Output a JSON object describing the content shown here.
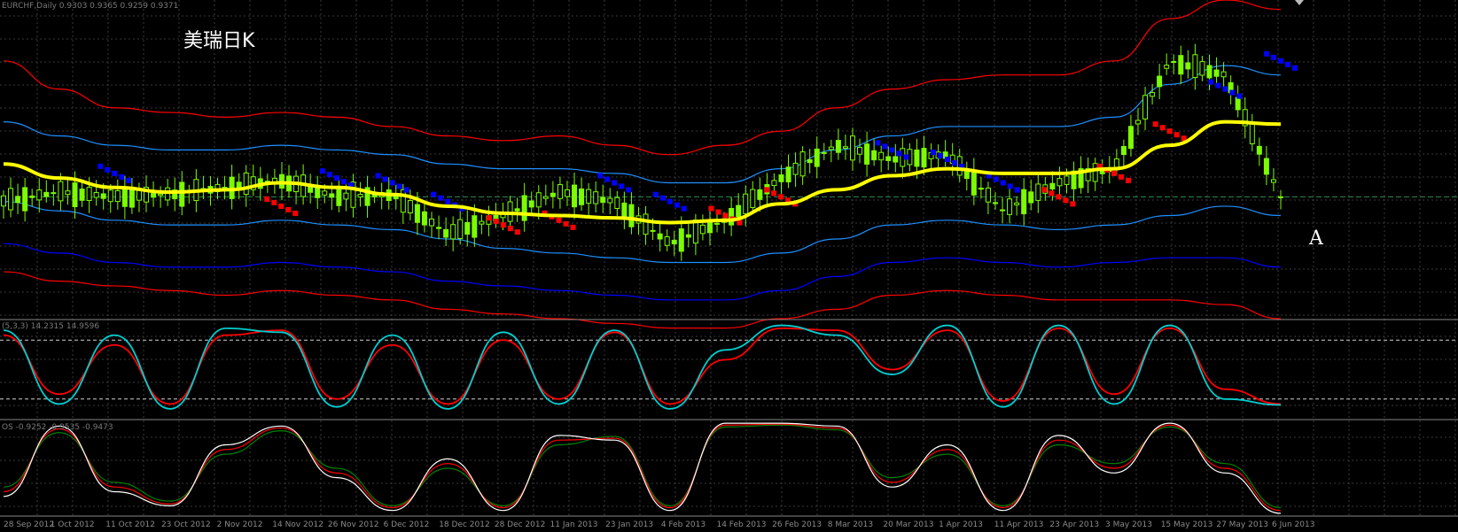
{
  "header": {
    "symbol_label": "EURCHF,Daily  0.9303 0.9365 0.9259 0.9371",
    "chart_title": "美瑞日K",
    "marker_label": "A"
  },
  "stoch_pane": {
    "label": "(5,3,3) 14.2315 14.9596"
  },
  "lower_pane": {
    "label": "OS -0.9252 -0.9535 -0.9473"
  },
  "x_axis": {
    "dates": [
      "28 Sep 2012",
      "1 Oct 2012",
      "11 Oct 2012",
      "23 Oct 2012",
      "2 Nov 2012",
      "14 Nov 2012",
      "26 Nov 2012",
      "6 Dec 2012",
      "18 Dec 2012",
      "28 Dec 2012",
      "11 Jan 2013",
      "23 Jan 2013",
      "4 Feb 2013",
      "14 Feb 2013",
      "26 Feb 2013",
      "8 Mar 2013",
      "20 Mar 2013",
      "1 Apr 2013",
      "11 Apr 2013",
      "23 Apr 2013",
      "3 May 2013",
      "15 May 2013",
      "27 May 2013",
      "6 Jun 2013"
    ]
  },
  "colors": {
    "background": "#000000",
    "grid": "#3a3a3a",
    "candle": "#7cfc00",
    "ma_yellow": "#ffff00",
    "band_red": "#ff0000",
    "band_blue": "#0000ff",
    "band_cyan": "#1e90ff",
    "sar_blue": "#0000ff",
    "sar_red": "#ff0000",
    "stoch_main": "#00ced1",
    "stoch_signal": "#ff0000",
    "lower_main": "#ffffff",
    "lower_signal": "#ff0000",
    "lower_third": "#008000"
  },
  "chart_data": [
    {
      "type": "line",
      "title": "美瑞日K",
      "description": "Daily price candles with moving average, envelope bands and dot markers",
      "x": [
        "28 Sep 2012",
        "1 Oct 2012",
        "11 Oct 2012",
        "23 Oct 2012",
        "2 Nov 2012",
        "14 Nov 2012",
        "26 Nov 2012",
        "6 Dec 2012",
        "18 Dec 2012",
        "28 Dec 2012",
        "11 Jan 2013",
        "23 Jan 2013",
        "4 Feb 2013",
        "14 Feb 2013",
        "26 Feb 2013",
        "8 Mar 2013",
        "20 Mar 2013",
        "1 Apr 2013",
        "11 Apr 2013",
        "23 Apr 2013",
        "3 May 2013",
        "15 May 2013",
        "27 May 2013",
        "6 Jun 2013"
      ],
      "series": [
        {
          "key": "close",
          "values": [
            0.929,
            0.931,
            0.93,
            0.9305,
            0.932,
            0.9335,
            0.93,
            0.9305,
            0.922,
            0.926,
            0.931,
            0.929,
            0.92,
            0.925,
            0.934,
            0.941,
            0.938,
            0.939,
            0.927,
            0.933,
            0.936,
            0.959,
            0.956,
            0.93
          ]
        },
        {
          "key": "ma",
          "values": [
            0.937,
            0.934,
            0.932,
            0.931,
            0.9315,
            0.933,
            0.932,
            0.9305,
            0.928,
            0.9265,
            0.926,
            0.9255,
            0.9245,
            0.925,
            0.9285,
            0.9315,
            0.9345,
            0.936,
            0.935,
            0.935,
            0.936,
            0.941,
            0.946,
            0.9455
          ]
        },
        {
          "key": "red_upper",
          "values": [
            0.959,
            0.953,
            0.949,
            0.948,
            0.947,
            0.948,
            0.947,
            0.945,
            0.943,
            0.942,
            0.943,
            0.941,
            0.939,
            0.941,
            0.944,
            0.949,
            0.953,
            0.955,
            0.956,
            0.956,
            0.959,
            0.968,
            0.972,
            0.97
          ]
        },
        {
          "key": "cyan_upper",
          "values": [
            0.946,
            0.943,
            0.941,
            0.94,
            0.94,
            0.941,
            0.94,
            0.939,
            0.937,
            0.936,
            0.936,
            0.935,
            0.933,
            0.933,
            0.936,
            0.94,
            0.943,
            0.945,
            0.945,
            0.945,
            0.947,
            0.954,
            0.958,
            0.956
          ]
        },
        {
          "key": "cyan_lower",
          "values": [
            0.929,
            0.927,
            0.925,
            0.924,
            0.924,
            0.925,
            0.924,
            0.923,
            0.921,
            0.919,
            0.918,
            0.917,
            0.916,
            0.916,
            0.918,
            0.921,
            0.924,
            0.925,
            0.924,
            0.923,
            0.924,
            0.926,
            0.928,
            0.926
          ]
        },
        {
          "key": "blue_lower",
          "values": [
            0.92,
            0.918,
            0.916,
            0.915,
            0.915,
            0.916,
            0.915,
            0.914,
            0.912,
            0.911,
            0.91,
            0.909,
            0.908,
            0.908,
            0.91,
            0.913,
            0.916,
            0.917,
            0.916,
            0.915,
            0.916,
            0.917,
            0.917,
            0.915
          ]
        },
        {
          "key": "red_lower",
          "values": [
            0.914,
            0.912,
            0.911,
            0.91,
            0.909,
            0.91,
            0.909,
            0.908,
            0.906,
            0.905,
            0.904,
            0.903,
            0.902,
            0.902,
            0.904,
            0.906,
            0.909,
            0.91,
            0.909,
            0.908,
            0.908,
            0.908,
            0.907,
            0.904
          ]
        }
      ],
      "ylim": [
        0.904,
        0.972
      ],
      "reference_line": 0.93,
      "sar_dots": [
        {
          "i": 2,
          "v": 0.935,
          "c": "blue"
        },
        {
          "i": 5,
          "v": 0.928,
          "c": "red"
        },
        {
          "i": 6,
          "v": 0.934,
          "c": "blue"
        },
        {
          "i": 7,
          "v": 0.933,
          "c": "blue"
        },
        {
          "i": 8,
          "v": 0.929,
          "c": "blue"
        },
        {
          "i": 9,
          "v": 0.924,
          "c": "red"
        },
        {
          "i": 10,
          "v": 0.925,
          "c": "red"
        },
        {
          "i": 11,
          "v": 0.933,
          "c": "blue"
        },
        {
          "i": 12,
          "v": 0.929,
          "c": "blue"
        },
        {
          "i": 13,
          "v": 0.926,
          "c": "red"
        },
        {
          "i": 14,
          "v": 0.93,
          "c": "red"
        },
        {
          "i": 16,
          "v": 0.94,
          "c": "blue"
        },
        {
          "i": 17,
          "v": 0.938,
          "c": "blue"
        },
        {
          "i": 18,
          "v": 0.933,
          "c": "blue"
        },
        {
          "i": 19,
          "v": 0.93,
          "c": "red"
        },
        {
          "i": 20,
          "v": 0.935,
          "c": "red"
        },
        {
          "i": 21,
          "v": 0.944,
          "c": "red"
        },
        {
          "i": 22,
          "v": 0.953,
          "c": "blue"
        },
        {
          "i": 23,
          "v": 0.959,
          "c": "blue"
        }
      ],
      "grid": true
    },
    {
      "type": "line",
      "title": "(5,3,3) 14.2315 14.9596",
      "x": [
        "28 Sep 2012",
        "1 Oct 2012",
        "11 Oct 2012",
        "23 Oct 2012",
        "2 Nov 2012",
        "14 Nov 2012",
        "26 Nov 2012",
        "6 Dec 2012",
        "18 Dec 2012",
        "28 Dec 2012",
        "11 Jan 2013",
        "23 Jan 2013",
        "4 Feb 2013",
        "14 Feb 2013",
        "26 Feb 2013",
        "8 Mar 2013",
        "20 Mar 2013",
        "1 Apr 2013",
        "11 Apr 2013",
        "23 Apr 2013",
        "3 May 2013",
        "15 May 2013",
        "27 May 2013",
        "6 Jun 2013"
      ],
      "series": [
        {
          "key": "main",
          "values": [
            90,
            15,
            85,
            10,
            92,
            88,
            12,
            85,
            10,
            88,
            15,
            90,
            10,
            70,
            95,
            85,
            45,
            95,
            12,
            95,
            15,
            95,
            20,
            14
          ]
        },
        {
          "key": "signal",
          "values": [
            85,
            25,
            75,
            15,
            85,
            90,
            20,
            75,
            15,
            80,
            20,
            88,
            15,
            60,
            92,
            90,
            50,
            90,
            18,
            92,
            25,
            92,
            30,
            15
          ]
        }
      ],
      "ylim": [
        0,
        100
      ],
      "levels": [
        80,
        20
      ],
      "grid": true
    },
    {
      "type": "line",
      "title": "OS -0.9252 -0.9535 -0.9473",
      "x": [
        "28 Sep 2012",
        "1 Oct 2012",
        "11 Oct 2012",
        "23 Oct 2012",
        "2 Nov 2012",
        "14 Nov 2012",
        "26 Nov 2012",
        "6 Dec 2012",
        "18 Dec 2012",
        "28 Dec 2012",
        "11 Jan 2013",
        "23 Jan 2013",
        "4 Feb 2013",
        "14 Feb 2013",
        "26 Feb 2013",
        "8 Mar 2013",
        "20 Mar 2013",
        "1 Apr 2013",
        "11 Apr 2013",
        "23 Apr 2013",
        "3 May 2013",
        "15 May 2013",
        "27 May 2013",
        "6 Jun 2013"
      ],
      "series": [
        {
          "key": "white",
          "values": [
            0.2,
            0.95,
            0.25,
            0.1,
            0.75,
            0.95,
            0.4,
            0.05,
            0.6,
            0.05,
            0.85,
            0.8,
            0.05,
            0.98,
            0.98,
            0.95,
            0.3,
            0.75,
            0.05,
            0.85,
            0.45,
            0.98,
            0.45,
            0.02
          ]
        },
        {
          "key": "red",
          "values": [
            0.25,
            0.92,
            0.3,
            0.12,
            0.7,
            0.93,
            0.45,
            0.08,
            0.55,
            0.08,
            0.8,
            0.82,
            0.08,
            0.96,
            0.97,
            0.93,
            0.35,
            0.7,
            0.08,
            0.8,
            0.5,
            0.96,
            0.5,
            0.05
          ]
        },
        {
          "key": "green",
          "values": [
            0.3,
            0.88,
            0.35,
            0.15,
            0.65,
            0.9,
            0.5,
            0.1,
            0.5,
            0.1,
            0.75,
            0.84,
            0.1,
            0.94,
            0.96,
            0.91,
            0.4,
            0.65,
            0.1,
            0.75,
            0.55,
            0.94,
            0.55,
            0.08
          ]
        }
      ],
      "ylim": [
        0,
        1
      ],
      "grid": true
    }
  ]
}
